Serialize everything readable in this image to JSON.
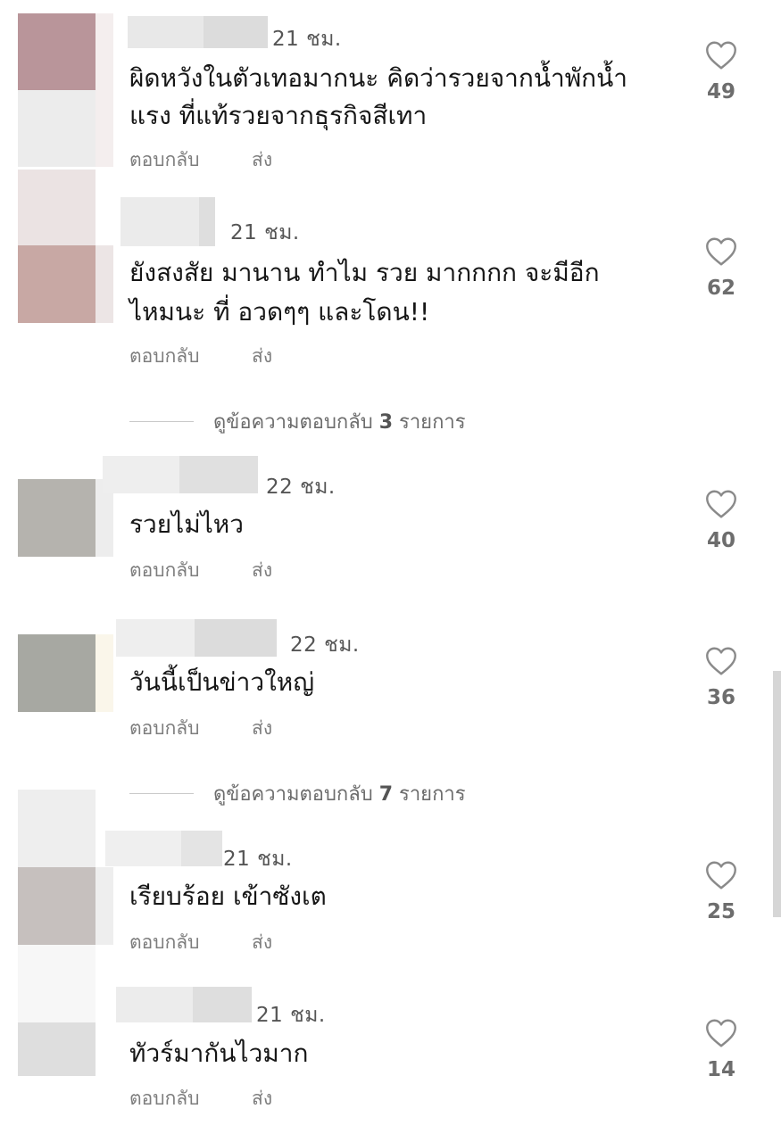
{
  "comments": [
    {
      "time": "21 ชม.",
      "line1": "ผิดหวังในตัวเทอมากนะ คิดว่ารวยจากน้ำพักน้ำ",
      "line2": "แรง ที่แท้รวยจากธุรกิจสีเทา",
      "reply": "ตอบกลับ",
      "send": "ส่ง",
      "likes": "49"
    },
    {
      "time": "21 ชม.",
      "line1": "ยังสงสัย มานาน ทำไม รวย มากกกก จะมีอีก",
      "line2": "ไหมนะ ที่ อวดๆๆ และโดน!!",
      "reply": "ตอบกลับ",
      "send": "ส่ง",
      "likes": "62"
    },
    {
      "time": "22 ชม.",
      "line1": "รวยไม่ไหว",
      "reply": "ตอบกลับ",
      "send": "ส่ง",
      "likes": "40"
    },
    {
      "time": "22 ชม.",
      "line1": "วันนี้เป็นข่าวใหญ่",
      "reply": "ตอบกลับ",
      "send": "ส่ง",
      "likes": "36"
    },
    {
      "time": "21 ชม.",
      "line1": "เรียบร้อย เข้าซังเต",
      "reply": "ตอบกลับ",
      "send": "ส่ง",
      "likes": "25"
    },
    {
      "time": "21 ชม.",
      "line1": "ทัวร์มากันไวมาก",
      "reply": "ตอบกลับ",
      "send": "ส่ง",
      "likes": "14"
    }
  ],
  "view_replies": [
    {
      "prefix": "ดูข้อความตอบกลับ ",
      "count": "3",
      "suffix": " รายการ"
    },
    {
      "prefix": "ดูข้อความตอบกลับ ",
      "count": "7",
      "suffix": " รายการ"
    }
  ],
  "icons": {
    "like": "heart-outline-icon"
  },
  "colors": {
    "text": "#161616",
    "secondary": "#7d7d7d",
    "heart": "#8a8a8a",
    "censor": "#e6e6e6"
  }
}
